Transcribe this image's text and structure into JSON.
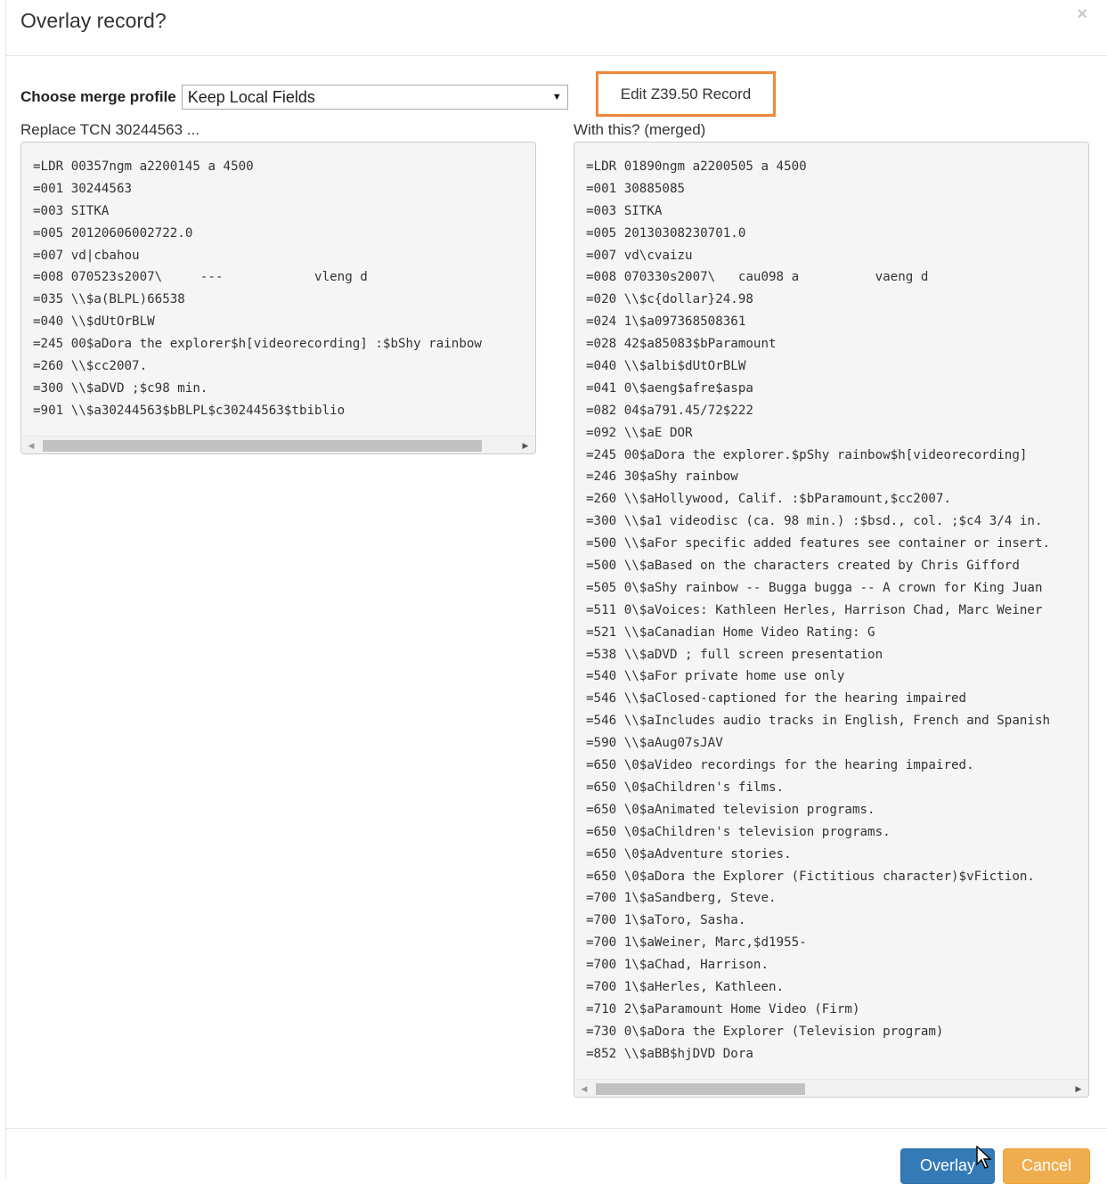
{
  "dialog": {
    "title": "Overlay record?",
    "close_glyph": "×"
  },
  "merge_profile": {
    "label": "Choose merge profile",
    "selected": "Keep Local Fields",
    "arrow": "▼"
  },
  "edit_button": {
    "label": "Edit Z39.50 Record"
  },
  "left_pane": {
    "caption": "Replace TCN 30244563 ...",
    "lines": [
      "=LDR 00357ngm a2200145 a 4500",
      "=001 30244563",
      "=003 SITKA",
      "=005 20120606002722.0",
      "=007 vd|cbahou",
      "=008 070523s2007\\     ---            vleng d",
      "=035 \\\\$a(BLPL)66538",
      "=040 \\\\$dUtOrBLW",
      "=245 00$aDora the explorer$h[videorecording] :$bShy rainbow",
      "=260 \\\\$cc2007.",
      "=300 \\\\$aDVD ;$c98 min.",
      "=901 \\\\$a30244563$bBLPL$c30244563$tbiblio"
    ]
  },
  "right_pane": {
    "caption": "With this? (merged)",
    "lines": [
      "=LDR 01890ngm a2200505 a 4500",
      "=001 30885085",
      "=003 SITKA",
      "=005 20130308230701.0",
      "=007 vd\\cvaizu",
      "=008 070330s2007\\   cau098 a          vaeng d",
      "=020 \\\\$c{dollar}24.98",
      "=024 1\\$a097368508361",
      "=028 42$a85083$bParamount",
      "=040 \\\\$albi$dUtOrBLW",
      "=041 0\\$aeng$afre$aspa",
      "=082 04$a791.45/72$222",
      "=092 \\\\$aE DOR",
      "=245 00$aDora the explorer.$pShy rainbow$h[videorecording]",
      "=246 30$aShy rainbow",
      "=260 \\\\$aHollywood, Calif. :$bParamount,$cc2007.",
      "=300 \\\\$a1 videodisc (ca. 98 min.) :$bsd., col. ;$c4 3/4 in.",
      "=500 \\\\$aFor specific added features see container or insert.",
      "=500 \\\\$aBased on the characters created by Chris Gifford",
      "=505 0\\$aShy rainbow -- Bugga bugga -- A crown for King Juan",
      "=511 0\\$aVoices: Kathleen Herles, Harrison Chad, Marc Weiner",
      "=521 \\\\$aCanadian Home Video Rating: G",
      "=538 \\\\$aDVD ; full screen presentation",
      "=540 \\\\$aFor private home use only",
      "=546 \\\\$aClosed-captioned for the hearing impaired",
      "=546 \\\\$aIncludes audio tracks in English, French and Spanish",
      "=590 \\\\$aAug07sJAV",
      "=650 \\0$aVideo recordings for the hearing impaired.",
      "=650 \\0$aChildren's films.",
      "=650 \\0$aAnimated television programs.",
      "=650 \\0$aChildren's television programs.",
      "=650 \\0$aAdventure stories.",
      "=650 \\0$aDora the Explorer (Fictitious character)$vFiction.",
      "=700 1\\$aSandberg, Steve.",
      "=700 1\\$aToro, Sasha.",
      "=700 1\\$aWeiner, Marc,$d1955-",
      "=700 1\\$aChad, Harrison.",
      "=700 1\\$aHerles, Kathleen.",
      "=710 2\\$aParamount Home Video (Firm)",
      "=730 0\\$aDora the Explorer (Television program)",
      "=852 \\\\$aBB$hjDVD Dora"
    ]
  },
  "footer": {
    "overlay_label": "Overlay",
    "cancel_label": "Cancel"
  },
  "colors": {
    "primary": "#337ab7",
    "warning": "#f0ad4e",
    "highlight_border": "#f0883a"
  }
}
